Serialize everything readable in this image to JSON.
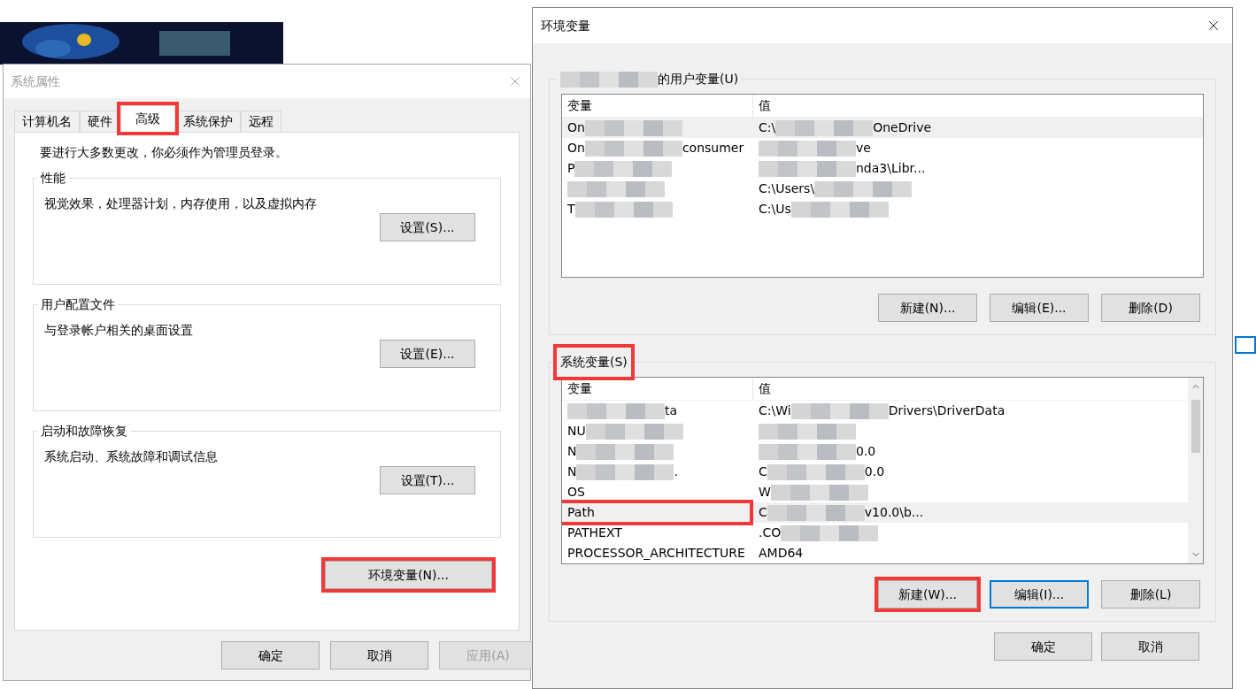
{
  "system_properties": {
    "title": "系统属性",
    "tabs": [
      {
        "label": "计算机名",
        "selected": false,
        "highlighted": false
      },
      {
        "label": "硬件",
        "selected": false,
        "highlighted": false
      },
      {
        "label": "高级",
        "selected": true,
        "highlighted": true
      },
      {
        "label": "系统保护",
        "selected": false,
        "highlighted": false
      },
      {
        "label": "远程",
        "selected": false,
        "highlighted": false
      }
    ],
    "notice": "要进行大多数更改，你必须作为管理员登录。",
    "groups": [
      {
        "title": "性能",
        "description": "视觉效果，处理器计划，内存使用，以及虚拟内存",
        "button": "设置(S)..."
      },
      {
        "title": "用户配置文件",
        "description": "与登录帐户相关的桌面设置",
        "button": "设置(E)..."
      },
      {
        "title": "启动和故障恢复",
        "description": "系统启动、系统故障和调试信息",
        "button": "设置(T)..."
      }
    ],
    "env_button": {
      "label": "环境变量(N)...",
      "highlighted": true
    },
    "buttons": [
      {
        "label": "确定",
        "disabled": false
      },
      {
        "label": "取消",
        "disabled": false
      },
      {
        "label": "应用(A)",
        "disabled": true
      }
    ]
  },
  "environment_variables": {
    "title": "环境变量",
    "user_section": {
      "title": [
        {
          "kind": "blur"
        },
        {
          "kind": "text",
          "text": "的用户变量(U)"
        }
      ],
      "highlighted": false,
      "columns": [
        "变量",
        "值"
      ],
      "rows": [
        {
          "selected": true,
          "highlighted": false,
          "variable": [
            {
              "kind": "text",
              "text": "On"
            },
            {
              "kind": "blur"
            }
          ],
          "value": [
            {
              "kind": "text",
              "text": "C:\\"
            },
            {
              "kind": "blur"
            },
            {
              "kind": "text",
              "text": "OneDrive"
            }
          ]
        },
        {
          "selected": false,
          "highlighted": false,
          "variable": [
            {
              "kind": "text",
              "text": "On"
            },
            {
              "kind": "blur"
            },
            {
              "kind": "text",
              "text": "consumer"
            }
          ],
          "value": [
            {
              "kind": "blur"
            },
            {
              "kind": "text",
              "text": "ve"
            }
          ]
        },
        {
          "selected": false,
          "highlighted": false,
          "variable": [
            {
              "kind": "text",
              "text": "P"
            },
            {
              "kind": "blur"
            }
          ],
          "value": [
            {
              "kind": "blur"
            },
            {
              "kind": "text",
              "text": "nda3\\Libr..."
            }
          ]
        },
        {
          "selected": false,
          "highlighted": false,
          "variable": [
            {
              "kind": "blur"
            }
          ],
          "value": [
            {
              "kind": "text",
              "text": "C:\\Users\\"
            },
            {
              "kind": "blur"
            }
          ]
        },
        {
          "selected": false,
          "highlighted": false,
          "variable": [
            {
              "kind": "text",
              "text": "T"
            },
            {
              "kind": "blur"
            }
          ],
          "value": [
            {
              "kind": "text",
              "text": "C:\\Us"
            },
            {
              "kind": "blur"
            }
          ]
        }
      ],
      "buttons": [
        {
          "label": "新建(N)...",
          "highlighted": false,
          "focused": false
        },
        {
          "label": "编辑(E)...",
          "highlighted": false,
          "focused": false
        },
        {
          "label": "删除(D)",
          "highlighted": false,
          "focused": false
        }
      ]
    },
    "system_section": {
      "title": [
        {
          "kind": "text",
          "text": "系统变量(S)"
        }
      ],
      "highlighted": true,
      "columns": [
        "变量",
        "值"
      ],
      "rows": [
        {
          "selected": false,
          "highlighted": false,
          "variable": [
            {
              "kind": "blur"
            },
            {
              "kind": "text",
              "text": "ta"
            }
          ],
          "value": [
            {
              "kind": "text",
              "text": "C:\\Wi"
            },
            {
              "kind": "blur"
            },
            {
              "kind": "text",
              "text": "Drivers\\DriverData"
            }
          ]
        },
        {
          "selected": false,
          "highlighted": false,
          "variable": [
            {
              "kind": "text",
              "text": "NU"
            },
            {
              "kind": "blur"
            }
          ],
          "value": [
            {
              "kind": "blur"
            }
          ]
        },
        {
          "selected": false,
          "highlighted": false,
          "variable": [
            {
              "kind": "text",
              "text": "N"
            },
            {
              "kind": "blur"
            }
          ],
          "value": [
            {
              "kind": "blur"
            },
            {
              "kind": "text",
              "text": "0.0"
            }
          ]
        },
        {
          "selected": false,
          "highlighted": false,
          "variable": [
            {
              "kind": "text",
              "text": "N"
            },
            {
              "kind": "blur"
            },
            {
              "kind": "text",
              "text": "."
            }
          ],
          "value": [
            {
              "kind": "text",
              "text": "C"
            },
            {
              "kind": "blur"
            },
            {
              "kind": "text",
              "text": "0.0"
            }
          ]
        },
        {
          "selected": false,
          "highlighted": false,
          "variable": [
            {
              "kind": "text",
              "text": "OS"
            }
          ],
          "value": [
            {
              "kind": "text",
              "text": "W"
            },
            {
              "kind": "blur"
            }
          ]
        },
        {
          "selected": true,
          "highlighted": true,
          "variable": [
            {
              "kind": "text",
              "text": "Path"
            }
          ],
          "value": [
            {
              "kind": "text",
              "text": "C"
            },
            {
              "kind": "blur"
            },
            {
              "kind": "text",
              "text": "v10.0\\b..."
            }
          ]
        },
        {
          "selected": false,
          "highlighted": false,
          "variable": [
            {
              "kind": "text",
              "text": "PATHEXT"
            }
          ],
          "value": [
            {
              "kind": "text",
              "text": ".CO"
            },
            {
              "kind": "blur"
            }
          ]
        },
        {
          "selected": false,
          "highlighted": false,
          "variable": [
            {
              "kind": "text",
              "text": "PROCESSOR_ARCHITECTURE"
            }
          ],
          "value": [
            {
              "kind": "text",
              "text": "AMD64"
            }
          ]
        }
      ],
      "buttons": [
        {
          "label": "新建(W)...",
          "highlighted": true,
          "focused": false
        },
        {
          "label": "编辑(I)...",
          "highlighted": false,
          "focused": true
        },
        {
          "label": "删除(L)",
          "highlighted": false,
          "focused": false
        }
      ]
    },
    "buttons": [
      {
        "label": "确定"
      },
      {
        "label": "取消"
      }
    ]
  }
}
